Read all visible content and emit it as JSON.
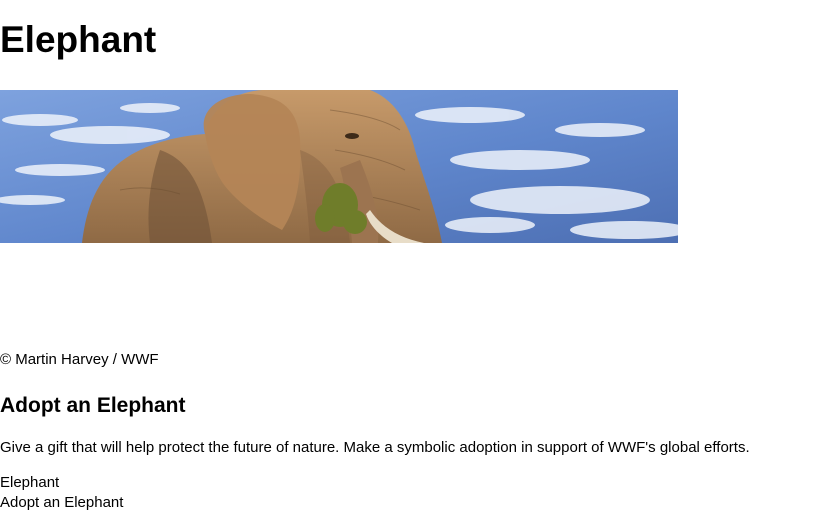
{
  "page": {
    "title": "Elephant"
  },
  "hero": {
    "image_subject": "elephant-photo",
    "colors": {
      "sky": "#5f86cc",
      "elephant": "#b98b5c",
      "tusk": "#e8ddc8",
      "cloud": "#eef3fb"
    }
  },
  "credit": "© Martin Harvey / WWF",
  "adopt": {
    "heading": "Adopt an Elephant",
    "description": "Give a gift that will help protect the future of nature. Make a symbolic adoption in support of WWF's global efforts."
  },
  "links": [
    "Elephant",
    "Adopt an Elephant"
  ]
}
